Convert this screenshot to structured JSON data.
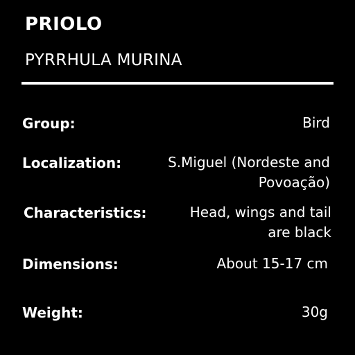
{
  "species": {
    "common_name": "PRIOLO",
    "scientific_name": "PYRRHULA MURINA"
  },
  "details": [
    {
      "label": "Group:",
      "value_lines": [
        "Bird"
      ]
    },
    {
      "label": "Localization:",
      "value_lines": [
        "S.Miguel (Nordeste and",
        "Povoação)"
      ]
    },
    {
      "label": "Characteristics:",
      "value_lines": [
        "Head, wings and tail",
        "are black"
      ]
    },
    {
      "label": "Dimensions:",
      "value_lines": [
        "About 15-17 cm"
      ]
    },
    {
      "label": "Weight:",
      "value_lines": [
        "30g"
      ]
    }
  ],
  "colors": {
    "background": "#000000",
    "text": "#ffffff",
    "divider": "#ffffff"
  }
}
